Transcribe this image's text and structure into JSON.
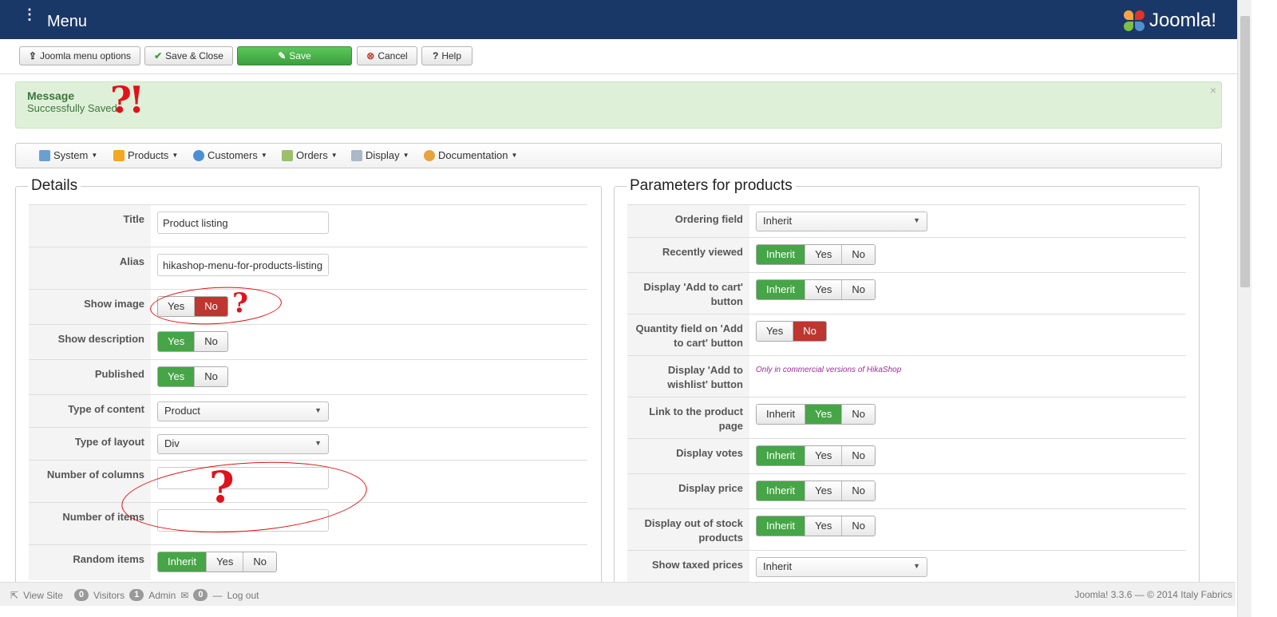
{
  "header": {
    "title": "Menu",
    "logo_text": "Joomla!"
  },
  "toolbar": {
    "menu_options": "Joomla menu options",
    "save_close": "Save & Close",
    "save": "Save",
    "cancel": "Cancel",
    "help": "Help"
  },
  "alert": {
    "heading": "Message",
    "message": "Successfully Saved",
    "close": "×"
  },
  "annotations": {
    "top": "?!",
    "q1": "?",
    "q2": "?"
  },
  "nav": [
    "System",
    "Products",
    "Customers",
    "Orders",
    "Display",
    "Documentation"
  ],
  "details": {
    "legend": "Details",
    "title_label": "Title",
    "title_value": "Product listing",
    "alias_label": "Alias",
    "alias_value": "hikashop-menu-for-products-listing",
    "show_image": "Show image",
    "show_description": "Show description",
    "published": "Published",
    "type_content": "Type of content",
    "type_content_value": "Product",
    "type_layout": "Type of layout",
    "type_layout_value": "Div",
    "num_columns": "Number of columns",
    "num_items": "Number of items",
    "random_items": "Random items"
  },
  "params": {
    "legend": "Parameters for products",
    "ordering": "Ordering field",
    "ordering_value": "Inherit",
    "recent": "Recently viewed",
    "add_cart": "Display 'Add to cart' button",
    "qty": "Quantity field on 'Add to cart' button",
    "wishlist": "Display 'Add to wishlist' button",
    "wishlist_note": "Only in commercial versions of HikaShop",
    "link": "Link to the product page",
    "votes": "Display votes",
    "price": "Display price",
    "stock": "Display out of stock products",
    "taxed": "Show taxed prices",
    "taxed_value": "Inherit"
  },
  "opts": {
    "yes": "Yes",
    "no": "No",
    "inherit": "Inherit"
  },
  "footer": {
    "view_site": "View Site",
    "visitors_count": "0",
    "visitors": "Visitors",
    "admin_count": "1",
    "admin": "Admin",
    "msg_count": "0",
    "logout": "Log out",
    "version": "Joomla! 3.3.6 — © 2014 Italy Fabrics"
  },
  "colors": {
    "header": "#1a3867",
    "green": "#46a546",
    "red": "#bd362f",
    "success_bg": "#dff0d8"
  }
}
